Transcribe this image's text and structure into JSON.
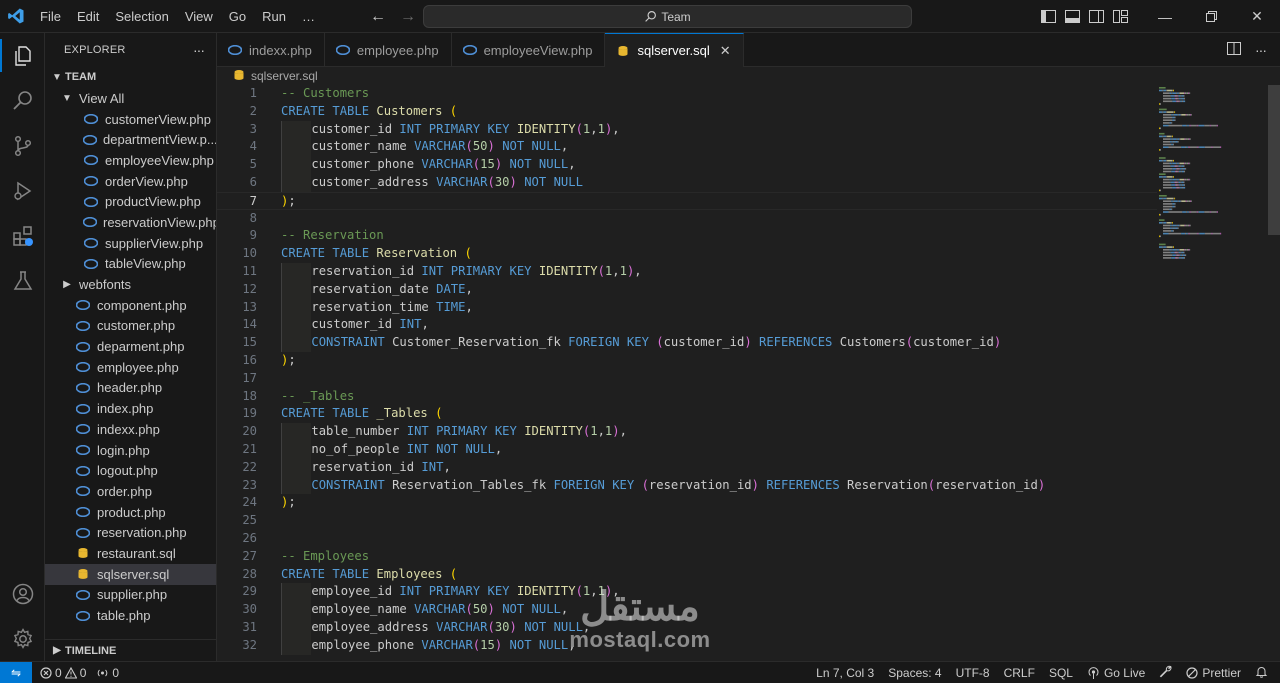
{
  "menu": [
    "File",
    "Edit",
    "Selection",
    "View",
    "Go",
    "Run",
    "…"
  ],
  "search": {
    "label": "Team"
  },
  "explorer": {
    "title": "EXPLORER",
    "more": "···",
    "root": "TEAM",
    "tree": [
      {
        "label": "View All",
        "type": "folder-open",
        "depth": 1
      },
      {
        "label": "customerView.php",
        "type": "php",
        "depth": 2
      },
      {
        "label": "departmentView.p...",
        "type": "php",
        "depth": 2
      },
      {
        "label": "employeeView.php",
        "type": "php",
        "depth": 2
      },
      {
        "label": "orderView.php",
        "type": "php",
        "depth": 2
      },
      {
        "label": "productView.php",
        "type": "php",
        "depth": 2
      },
      {
        "label": "reservationView.php",
        "type": "php",
        "depth": 2
      },
      {
        "label": "supplierView.php",
        "type": "php",
        "depth": 2
      },
      {
        "label": "tableView.php",
        "type": "php",
        "depth": 2
      },
      {
        "label": "webfonts",
        "type": "folder-closed",
        "depth": 1
      },
      {
        "label": "component.php",
        "type": "php",
        "depth": 1
      },
      {
        "label": "customer.php",
        "type": "php",
        "depth": 1
      },
      {
        "label": "deparment.php",
        "type": "php",
        "depth": 1
      },
      {
        "label": "employee.php",
        "type": "php",
        "depth": 1
      },
      {
        "label": "header.php",
        "type": "php",
        "depth": 1
      },
      {
        "label": "index.php",
        "type": "php",
        "depth": 1
      },
      {
        "label": "indexx.php",
        "type": "php",
        "depth": 1
      },
      {
        "label": "login.php",
        "type": "php",
        "depth": 1
      },
      {
        "label": "logout.php",
        "type": "php",
        "depth": 1
      },
      {
        "label": "order.php",
        "type": "php",
        "depth": 1
      },
      {
        "label": "product.php",
        "type": "php",
        "depth": 1
      },
      {
        "label": "reservation.php",
        "type": "php",
        "depth": 1
      },
      {
        "label": "restaurant.sql",
        "type": "sql",
        "depth": 1
      },
      {
        "label": "sqlserver.sql",
        "type": "sql",
        "depth": 1,
        "selected": true
      },
      {
        "label": "supplier.php",
        "type": "php",
        "depth": 1
      },
      {
        "label": "table.php",
        "type": "php",
        "depth": 1
      }
    ],
    "timeline": "TIMELINE"
  },
  "tabs": [
    {
      "label": "indexx.php",
      "type": "php"
    },
    {
      "label": "employee.php",
      "type": "php"
    },
    {
      "label": "employeeView.php",
      "type": "php"
    },
    {
      "label": "sqlserver.sql",
      "type": "sql",
      "active": true,
      "close": "✕"
    }
  ],
  "breadcrumb": "sqlserver.sql",
  "editor": {
    "current_line": 7,
    "lines": [
      {
        "n": "1",
        "indent": 0,
        "tokens": [
          [
            "c",
            "-- Customers"
          ]
        ]
      },
      {
        "n": "2",
        "indent": 0,
        "tokens": [
          [
            "k",
            "CREATE"
          ],
          [
            "",
            " "
          ],
          [
            "k",
            "TABLE"
          ],
          [
            "",
            " "
          ],
          [
            "id",
            "Customers"
          ],
          [
            "",
            " "
          ],
          [
            "p1",
            "("
          ]
        ]
      },
      {
        "n": "3",
        "indent": 1,
        "tokens": [
          [
            "",
            "customer_id "
          ],
          [
            "k",
            "INT"
          ],
          [
            "",
            " "
          ],
          [
            "k",
            "PRIMARY"
          ],
          [
            "",
            " "
          ],
          [
            "k",
            "KEY"
          ],
          [
            "",
            " "
          ],
          [
            "fn",
            "IDENTITY"
          ],
          [
            "p2",
            "("
          ],
          [
            "n",
            "1"
          ],
          [
            "",
            ","
          ],
          [
            "n",
            "1"
          ],
          [
            "p2",
            ")"
          ],
          [
            "",
            ","
          ]
        ]
      },
      {
        "n": "4",
        "indent": 1,
        "tokens": [
          [
            "",
            "customer_name "
          ],
          [
            "k",
            "VARCHAR"
          ],
          [
            "p2",
            "("
          ],
          [
            "n",
            "50"
          ],
          [
            "p2",
            ")"
          ],
          [
            "",
            " "
          ],
          [
            "k",
            "NOT"
          ],
          [
            "",
            " "
          ],
          [
            "k",
            "NULL"
          ],
          [
            "",
            ","
          ]
        ]
      },
      {
        "n": "5",
        "indent": 1,
        "tokens": [
          [
            "",
            "customer_phone "
          ],
          [
            "k",
            "VARCHAR"
          ],
          [
            "p2",
            "("
          ],
          [
            "n",
            "15"
          ],
          [
            "p2",
            ")"
          ],
          [
            "",
            " "
          ],
          [
            "k",
            "NOT"
          ],
          [
            "",
            " "
          ],
          [
            "k",
            "NULL"
          ],
          [
            "",
            ","
          ]
        ]
      },
      {
        "n": "6",
        "indent": 1,
        "tokens": [
          [
            "",
            "customer_address "
          ],
          [
            "k",
            "VARCHAR"
          ],
          [
            "p2",
            "("
          ],
          [
            "n",
            "30"
          ],
          [
            "p2",
            ")"
          ],
          [
            "",
            " "
          ],
          [
            "k",
            "NOT"
          ],
          [
            "",
            " "
          ],
          [
            "k",
            "NULL"
          ]
        ]
      },
      {
        "n": "7",
        "indent": 0,
        "tokens": [
          [
            "p1",
            ")"
          ],
          [
            "",
            ";"
          ]
        ]
      },
      {
        "n": "8",
        "indent": 0,
        "tokens": []
      },
      {
        "n": "9",
        "indent": 0,
        "tokens": [
          [
            "c",
            "-- Reservation"
          ]
        ]
      },
      {
        "n": "10",
        "indent": 0,
        "tokens": [
          [
            "k",
            "CREATE"
          ],
          [
            "",
            " "
          ],
          [
            "k",
            "TABLE"
          ],
          [
            "",
            " "
          ],
          [
            "id",
            "Reservation"
          ],
          [
            "",
            " "
          ],
          [
            "p1",
            "("
          ]
        ]
      },
      {
        "n": "11",
        "indent": 1,
        "tokens": [
          [
            "",
            "reservation_id "
          ],
          [
            "k",
            "INT"
          ],
          [
            "",
            " "
          ],
          [
            "k",
            "PRIMARY"
          ],
          [
            "",
            " "
          ],
          [
            "k",
            "KEY"
          ],
          [
            "",
            " "
          ],
          [
            "fn",
            "IDENTITY"
          ],
          [
            "p2",
            "("
          ],
          [
            "n",
            "1"
          ],
          [
            "",
            ","
          ],
          [
            "n",
            "1"
          ],
          [
            "p2",
            ")"
          ],
          [
            "",
            ","
          ]
        ]
      },
      {
        "n": "12",
        "indent": 1,
        "tokens": [
          [
            "",
            "reservation_date "
          ],
          [
            "k",
            "DATE"
          ],
          [
            "",
            ","
          ]
        ]
      },
      {
        "n": "13",
        "indent": 1,
        "tokens": [
          [
            "",
            "reservation_time "
          ],
          [
            "k",
            "TIME"
          ],
          [
            "",
            ","
          ]
        ]
      },
      {
        "n": "14",
        "indent": 1,
        "tokens": [
          [
            "",
            "customer_id "
          ],
          [
            "k",
            "INT"
          ],
          [
            "",
            ","
          ]
        ]
      },
      {
        "n": "15",
        "indent": 1,
        "tokens": [
          [
            "k",
            "CONSTRAINT"
          ],
          [
            "",
            " Customer_Reservation_fk "
          ],
          [
            "k",
            "FOREIGN"
          ],
          [
            "",
            " "
          ],
          [
            "k",
            "KEY"
          ],
          [
            "",
            " "
          ],
          [
            "p2",
            "("
          ],
          [
            "",
            "customer_id"
          ],
          [
            "p2",
            ")"
          ],
          [
            "",
            " "
          ],
          [
            "k",
            "REFERENCES"
          ],
          [
            "",
            " Customers"
          ],
          [
            "p2",
            "("
          ],
          [
            "",
            "customer_id"
          ],
          [
            "p2",
            ")"
          ]
        ]
      },
      {
        "n": "16",
        "indent": 0,
        "tokens": [
          [
            "p1",
            ")"
          ],
          [
            "",
            ";"
          ]
        ]
      },
      {
        "n": "17",
        "indent": 0,
        "tokens": []
      },
      {
        "n": "18",
        "indent": 0,
        "tokens": [
          [
            "c",
            "-- _Tables"
          ]
        ]
      },
      {
        "n": "19",
        "indent": 0,
        "tokens": [
          [
            "k",
            "CREATE"
          ],
          [
            "",
            " "
          ],
          [
            "k",
            "TABLE"
          ],
          [
            "",
            " "
          ],
          [
            "id",
            "_Tables"
          ],
          [
            "",
            " "
          ],
          [
            "p1",
            "("
          ]
        ]
      },
      {
        "n": "20",
        "indent": 1,
        "tokens": [
          [
            "",
            "table_number "
          ],
          [
            "k",
            "INT"
          ],
          [
            "",
            " "
          ],
          [
            "k",
            "PRIMARY"
          ],
          [
            "",
            " "
          ],
          [
            "k",
            "KEY"
          ],
          [
            "",
            " "
          ],
          [
            "fn",
            "IDENTITY"
          ],
          [
            "p2",
            "("
          ],
          [
            "n",
            "1"
          ],
          [
            "",
            ","
          ],
          [
            "n",
            "1"
          ],
          [
            "p2",
            ")"
          ],
          [
            "",
            ","
          ]
        ]
      },
      {
        "n": "21",
        "indent": 1,
        "tokens": [
          [
            "",
            "no_of_people "
          ],
          [
            "k",
            "INT"
          ],
          [
            "",
            " "
          ],
          [
            "k",
            "NOT"
          ],
          [
            "",
            " "
          ],
          [
            "k",
            "NULL"
          ],
          [
            "",
            ","
          ]
        ]
      },
      {
        "n": "22",
        "indent": 1,
        "tokens": [
          [
            "",
            "reservation_id "
          ],
          [
            "k",
            "INT"
          ],
          [
            "",
            ","
          ]
        ]
      },
      {
        "n": "23",
        "indent": 1,
        "tokens": [
          [
            "k",
            "CONSTRAINT"
          ],
          [
            "",
            " Reservation_Tables_fk "
          ],
          [
            "k",
            "FOREIGN"
          ],
          [
            "",
            " "
          ],
          [
            "k",
            "KEY"
          ],
          [
            "",
            " "
          ],
          [
            "p2",
            "("
          ],
          [
            "",
            "reservation_id"
          ],
          [
            "p2",
            ")"
          ],
          [
            "",
            " "
          ],
          [
            "k",
            "REFERENCES"
          ],
          [
            "",
            " Reservation"
          ],
          [
            "p2",
            "("
          ],
          [
            "",
            "reservation_id"
          ],
          [
            "p2",
            ")"
          ]
        ]
      },
      {
        "n": "24",
        "indent": 0,
        "tokens": [
          [
            "p1",
            ")"
          ],
          [
            "",
            ";"
          ]
        ]
      },
      {
        "n": "25",
        "indent": 0,
        "tokens": []
      },
      {
        "n": "26",
        "indent": 0,
        "tokens": []
      },
      {
        "n": "27",
        "indent": 0,
        "tokens": [
          [
            "c",
            "-- Employees"
          ]
        ]
      },
      {
        "n": "28",
        "indent": 0,
        "tokens": [
          [
            "k",
            "CREATE"
          ],
          [
            "",
            " "
          ],
          [
            "k",
            "TABLE"
          ],
          [
            "",
            " "
          ],
          [
            "id",
            "Employees"
          ],
          [
            "",
            " "
          ],
          [
            "p1",
            "("
          ]
        ]
      },
      {
        "n": "29",
        "indent": 1,
        "tokens": [
          [
            "",
            "employee_id "
          ],
          [
            "k",
            "INT"
          ],
          [
            "",
            " "
          ],
          [
            "k",
            "PRIMARY"
          ],
          [
            "",
            " "
          ],
          [
            "k",
            "KEY"
          ],
          [
            "",
            " "
          ],
          [
            "fn",
            "IDENTITY"
          ],
          [
            "p2",
            "("
          ],
          [
            "n",
            "1"
          ],
          [
            "",
            ","
          ],
          [
            "n",
            "1"
          ],
          [
            "p2",
            ")"
          ],
          [
            "",
            ","
          ]
        ]
      },
      {
        "n": "30",
        "indent": 1,
        "tokens": [
          [
            "",
            "employee_name "
          ],
          [
            "k",
            "VARCHAR"
          ],
          [
            "p2",
            "("
          ],
          [
            "n",
            "50"
          ],
          [
            "p2",
            ")"
          ],
          [
            "",
            " "
          ],
          [
            "k",
            "NOT"
          ],
          [
            "",
            " "
          ],
          [
            "k",
            "NULL"
          ],
          [
            "",
            ","
          ]
        ]
      },
      {
        "n": "31",
        "indent": 1,
        "tokens": [
          [
            "",
            "employee_address "
          ],
          [
            "k",
            "VARCHAR"
          ],
          [
            "p2",
            "("
          ],
          [
            "n",
            "30"
          ],
          [
            "p2",
            ")"
          ],
          [
            "",
            " "
          ],
          [
            "k",
            "NOT"
          ],
          [
            "",
            " "
          ],
          [
            "k",
            "NULL"
          ],
          [
            "",
            ","
          ]
        ]
      },
      {
        "n": "32",
        "indent": 1,
        "tokens": [
          [
            "",
            "employee_phone "
          ],
          [
            "k",
            "VARCHAR"
          ],
          [
            "p2",
            "("
          ],
          [
            "n",
            "15"
          ],
          [
            "p2",
            ")"
          ],
          [
            "",
            " "
          ],
          [
            "k",
            "NOT"
          ],
          [
            "",
            " "
          ],
          [
            "k",
            "NULL"
          ],
          [
            "",
            ","
          ]
        ]
      }
    ]
  },
  "status": {
    "errors": "0",
    "warnings": "0",
    "ports": "0",
    "position": "Ln 7, Col 3",
    "spaces": "Spaces: 4",
    "encoding": "UTF-8",
    "eol": "CRLF",
    "language": "SQL",
    "golive": "Go Live",
    "prettier": "Prettier"
  },
  "watermark": {
    "arabic": "مستقل",
    "latin": "mostaql.com"
  },
  "colors": {
    "accent": "#0078d4",
    "keyword": "#569cd6",
    "comment": "#6a9955",
    "number": "#b5cea8",
    "php_icon": "#4f8fd6",
    "sql_icon": "#e8b730"
  }
}
